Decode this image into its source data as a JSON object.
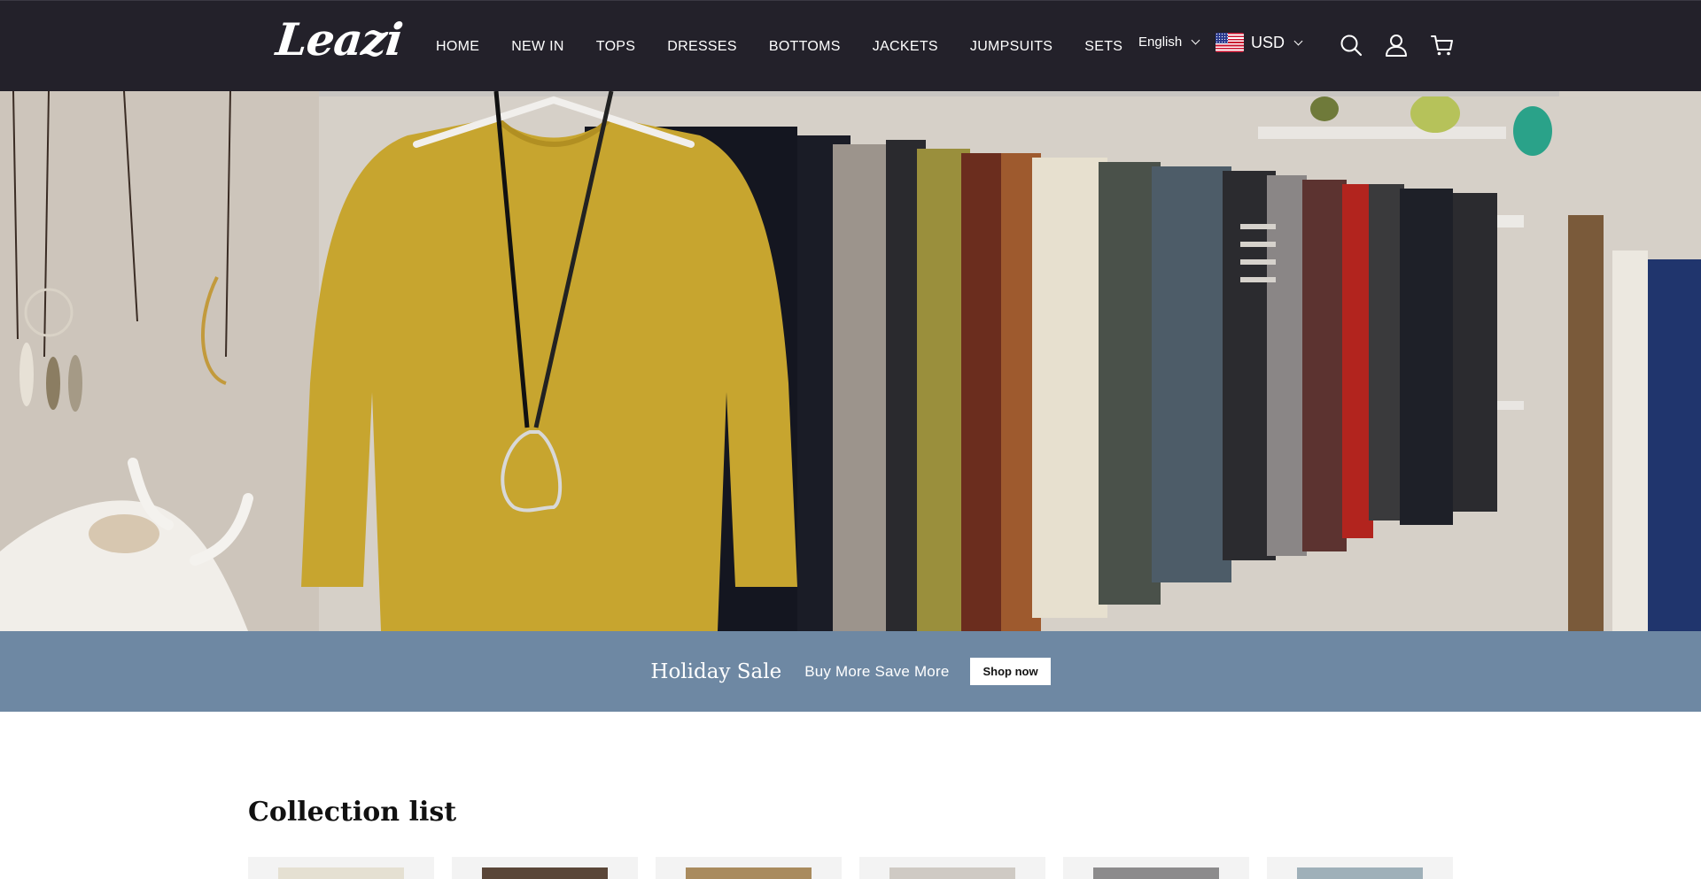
{
  "header": {
    "logo": "Leazi",
    "nav": [
      "HOME",
      "NEW IN",
      "TOPS",
      "DRESSES",
      "BOTTOMS",
      "JACKETS",
      "JUMPSUITS",
      "SETS"
    ],
    "language": "English",
    "currency": "USD",
    "icons": [
      "search-icon",
      "account-icon",
      "cart-icon"
    ]
  },
  "promo": {
    "title": "Holiday Sale",
    "subtitle": "Buy More Save More",
    "button": "Shop now",
    "background": "#6e88a3"
  },
  "collection": {
    "title": "Collection list"
  },
  "colors": {
    "header_bg": "#23212a",
    "accent": "#6e88a3"
  }
}
